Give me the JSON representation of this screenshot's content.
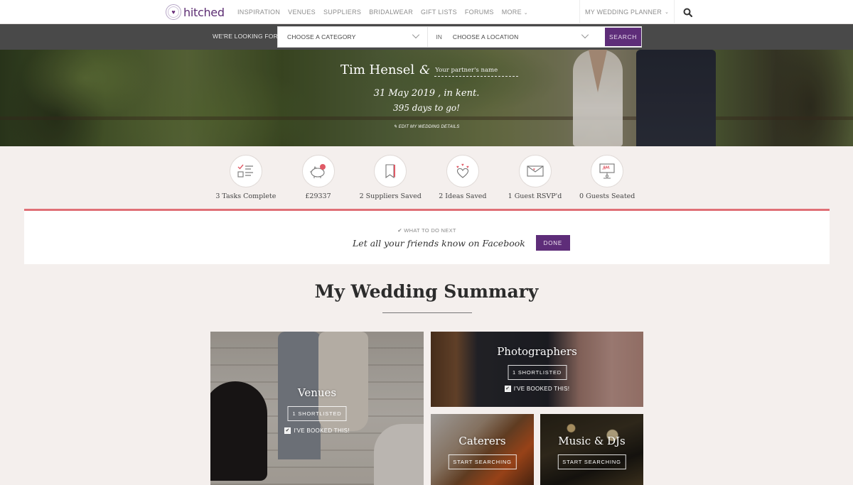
{
  "brand": {
    "name": "hitched",
    "color": "#5e2d79",
    "accent": "#e07077"
  },
  "nav": {
    "links": [
      "INSPIRATION",
      "VENUES",
      "SUPPLIERS",
      "BRIDALWEAR",
      "GIFT LISTS",
      "FORUMS",
      "MORE"
    ],
    "planner_label": "MY WEDDING PLANNER",
    "search_icon": "search-icon"
  },
  "search": {
    "lead_label": "WE'RE LOOKING FOR",
    "category_value": "CHOOSE A CATEGORY",
    "in_label": "IN",
    "location_value": "CHOOSE A LOCATION",
    "button_label": "SEARCH"
  },
  "hero": {
    "name": "Tim Hensel",
    "ampersand": "&",
    "partner_placeholder": "Your partner's name",
    "date_line": "31 May 2019 , in kent.",
    "countdown": "395 days to go!",
    "edit_label": "EDIT MY WEDDING DETAILS"
  },
  "stats": [
    {
      "icon": "checklist-icon",
      "label": "3 Tasks Complete"
    },
    {
      "icon": "piggy-bank-icon",
      "label": "£29337"
    },
    {
      "icon": "bookmark-icon",
      "label": "2 Suppliers Saved"
    },
    {
      "icon": "hearts-icon",
      "label": "2 Ideas Saved"
    },
    {
      "icon": "envelope-icon",
      "label": "1 Guest RSVP'd"
    },
    {
      "icon": "seating-chart-icon",
      "label": "0 Guests Seated"
    }
  ],
  "next": {
    "kicker": "WHAT TO DO NEXT",
    "text": "Let all your friends know on Facebook",
    "button_label": "DONE"
  },
  "summary": {
    "title": "My Wedding Summary",
    "cards": [
      {
        "title": "Venues",
        "button": "1 SHORTLISTED",
        "check_label": "I'VE BOOKED THIS!"
      },
      {
        "title": "Photographers",
        "button": "1 SHORTLISTED",
        "check_label": "I'VE BOOKED THIS!"
      },
      {
        "title": "Caterers",
        "button": "START SEARCHING"
      },
      {
        "title": "Music & DJs",
        "button": "START SEARCHING"
      }
    ]
  }
}
